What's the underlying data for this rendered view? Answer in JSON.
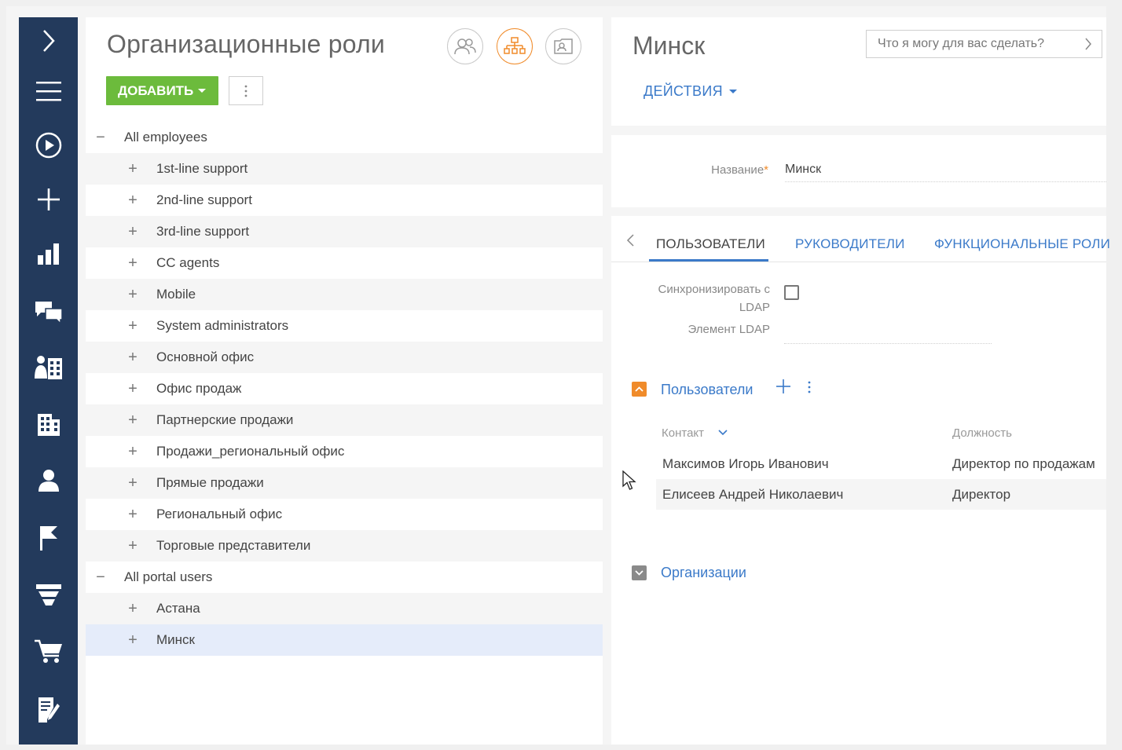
{
  "nav": {
    "items": [
      "expand",
      "menu",
      "play",
      "add",
      "chart",
      "chat",
      "org",
      "building",
      "person",
      "flag",
      "funnel",
      "cart",
      "notes"
    ]
  },
  "left": {
    "title": "Организационные роли",
    "add_label": "ДОБАВИТЬ",
    "tree": [
      {
        "label": "All employees",
        "level": 0,
        "toggle": "−"
      },
      {
        "label": "1st-line support",
        "level": 1,
        "toggle": "+"
      },
      {
        "label": "2nd-line support",
        "level": 1,
        "toggle": "+"
      },
      {
        "label": "3rd-line support",
        "level": 1,
        "toggle": "+"
      },
      {
        "label": "CC agents",
        "level": 1,
        "toggle": "+"
      },
      {
        "label": "Mobile",
        "level": 1,
        "toggle": "+"
      },
      {
        "label": "System administrators",
        "level": 1,
        "toggle": "+"
      },
      {
        "label": "Основной офис",
        "level": 1,
        "toggle": "+"
      },
      {
        "label": "Офис продаж",
        "level": 1,
        "toggle": "+"
      },
      {
        "label": "Партнерские продажи",
        "level": 1,
        "toggle": "+"
      },
      {
        "label": "Продажи_региональный офис",
        "level": 1,
        "toggle": "+"
      },
      {
        "label": "Прямые продажи",
        "level": 1,
        "toggle": "+"
      },
      {
        "label": "Региональный офис",
        "level": 1,
        "toggle": "+"
      },
      {
        "label": "Торговые представители",
        "level": 1,
        "toggle": "+"
      },
      {
        "label": "All portal users",
        "level": 0,
        "toggle": "−"
      },
      {
        "label": "Астана",
        "level": 1,
        "toggle": "+"
      },
      {
        "label": "Минск",
        "level": 1,
        "toggle": "+",
        "selected": true
      }
    ]
  },
  "right": {
    "name": "Минск",
    "ask_placeholder": "Что я могу для вас сделать?",
    "actions_label": "ДЕЙСТВИЯ",
    "field_label": "Название",
    "field_required": "*",
    "field_value": "Минск",
    "tabs": [
      "ПОЛЬЗОВАТЕЛИ",
      "РУКОВОДИТЕЛИ",
      "ФУНКЦИОНАЛЬНЫЕ РОЛИ"
    ],
    "sync_label_1": "Синхронизировать с",
    "sync_label_2": "LDAP",
    "ldap_label": "Элемент LDAP",
    "users_section": "Пользователи",
    "col_contact": "Контакт",
    "col_position": "Должность",
    "users": [
      {
        "contact": "Максимов Игорь Иванович",
        "position": "Директор по продажам"
      },
      {
        "contact": "Елисеев Андрей Николаевич",
        "position": "Директор"
      }
    ],
    "orgs_section": "Организации"
  },
  "colors": {
    "nav_bg": "#233a5c",
    "accent_green": "#6cbb3c",
    "accent_orange": "#f08b2a",
    "link_blue": "#3b7ac9",
    "selected_row": "#e5ecfa"
  }
}
